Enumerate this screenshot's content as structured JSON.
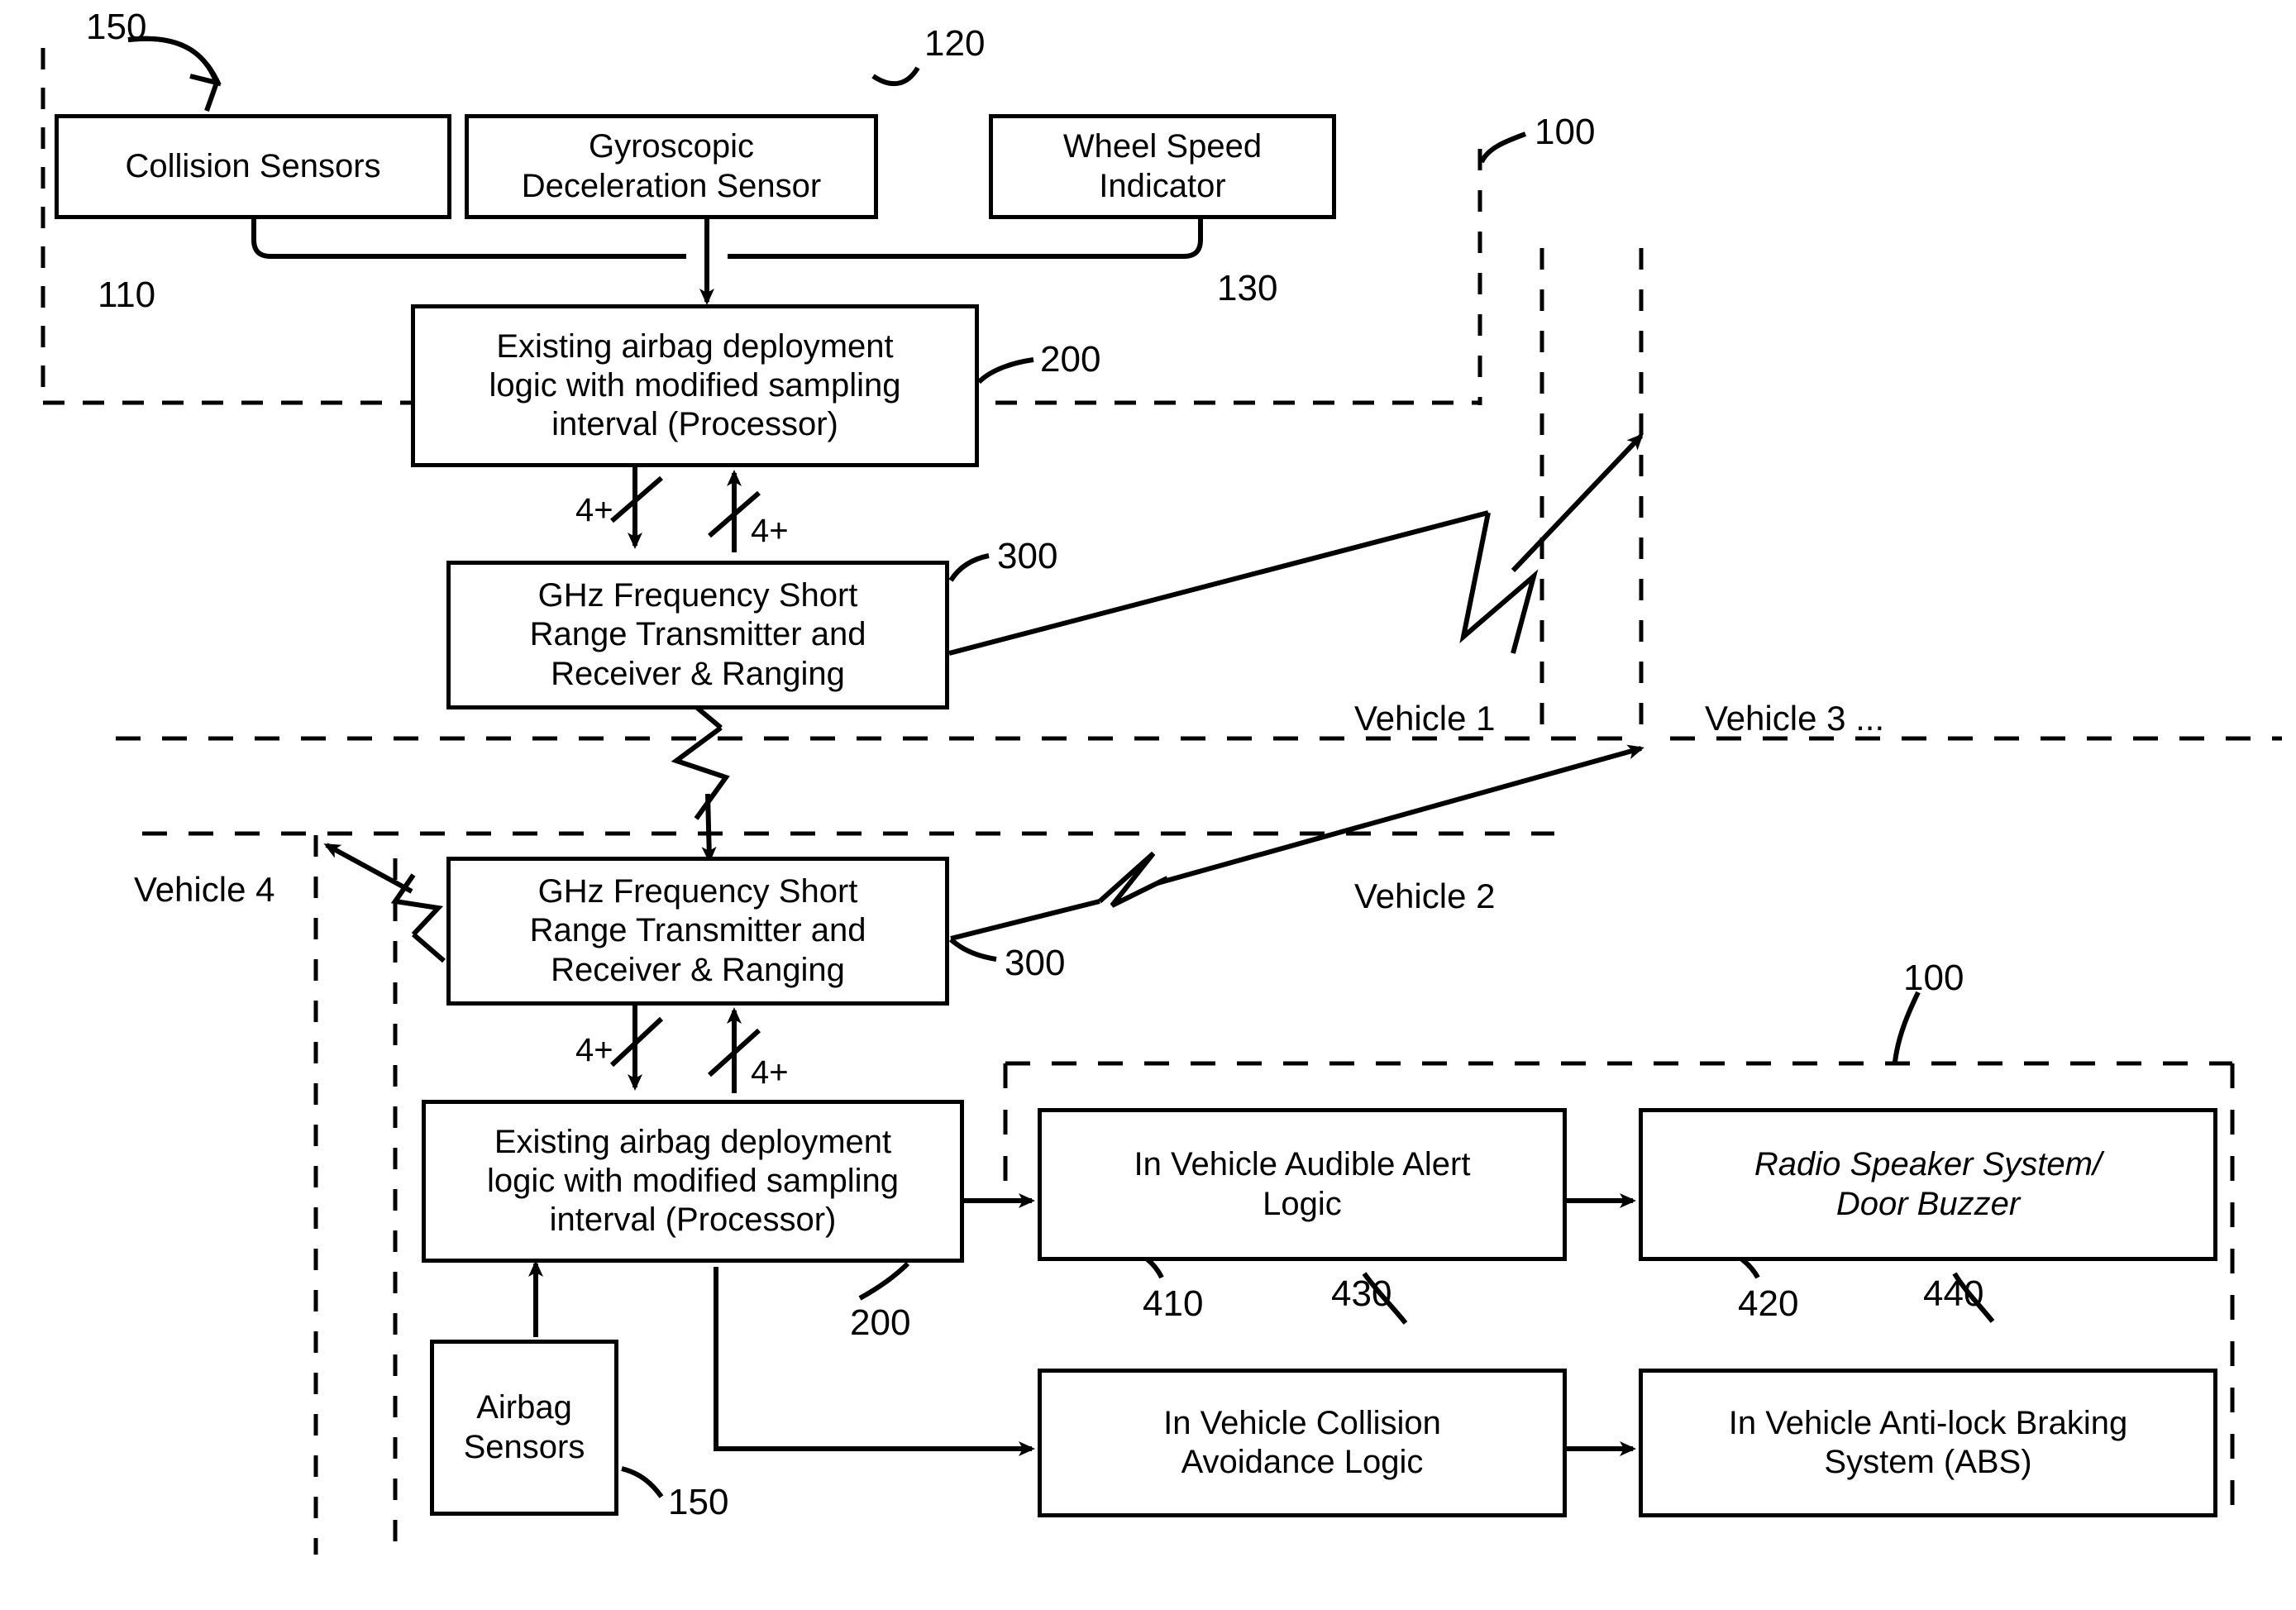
{
  "figure": {
    "type": "patent-block-diagram",
    "title": "Inter-vehicle airbag deployment / collision avoidance block diagram"
  },
  "boxes": {
    "collision_sensors": "Collision Sensors",
    "gyroscopic_sensor": "Gyroscopic\nDeceleration Sensor",
    "wheel_speed": "Wheel Speed\nIndicator",
    "airbag_logic_top": "Existing airbag deployment\nlogic with modified sampling\ninterval (Processor)",
    "ghz_top": "GHz Frequency Short\nRange Transmitter and\nReceiver & Ranging",
    "ghz_bottom": "GHz Frequency Short\nRange Transmitter and\nReceiver & Ranging",
    "airbag_logic_bottom": "Existing airbag deployment\nlogic with modified sampling\ninterval (Processor)",
    "airbag_sensors": "Airbag\nSensors",
    "audible_alert": "In Vehicle Audible Alert\nLogic",
    "radio_speaker": "Radio Speaker System/\nDoor Buzzer",
    "collision_avoidance": "In Vehicle Collision\nAvoidance Logic",
    "abs": "In Vehicle Anti-lock Braking\nSystem (ABS)"
  },
  "reference_numerals": {
    "n150_top": "150",
    "n110": "110",
    "n120": "120",
    "n130": "130",
    "n100_top": "100",
    "n200_top": "200",
    "n300_top": "300",
    "n300_bottom": "300",
    "n200_bottom": "200",
    "n150_bottom": "150",
    "n100_bottom": "100",
    "n410": "410",
    "n430": "430",
    "n420": "420",
    "n440": "440"
  },
  "signal_labels": {
    "bus_down_top": "4+",
    "bus_up_top": "4+",
    "bus_down_bottom": "4+",
    "bus_up_bottom": "4+"
  },
  "vehicle_labels": {
    "vehicle1": "Vehicle 1",
    "vehicle2": "Vehicle 2",
    "vehicle3": "Vehicle 3 ...",
    "vehicle4": "Vehicle 4"
  }
}
